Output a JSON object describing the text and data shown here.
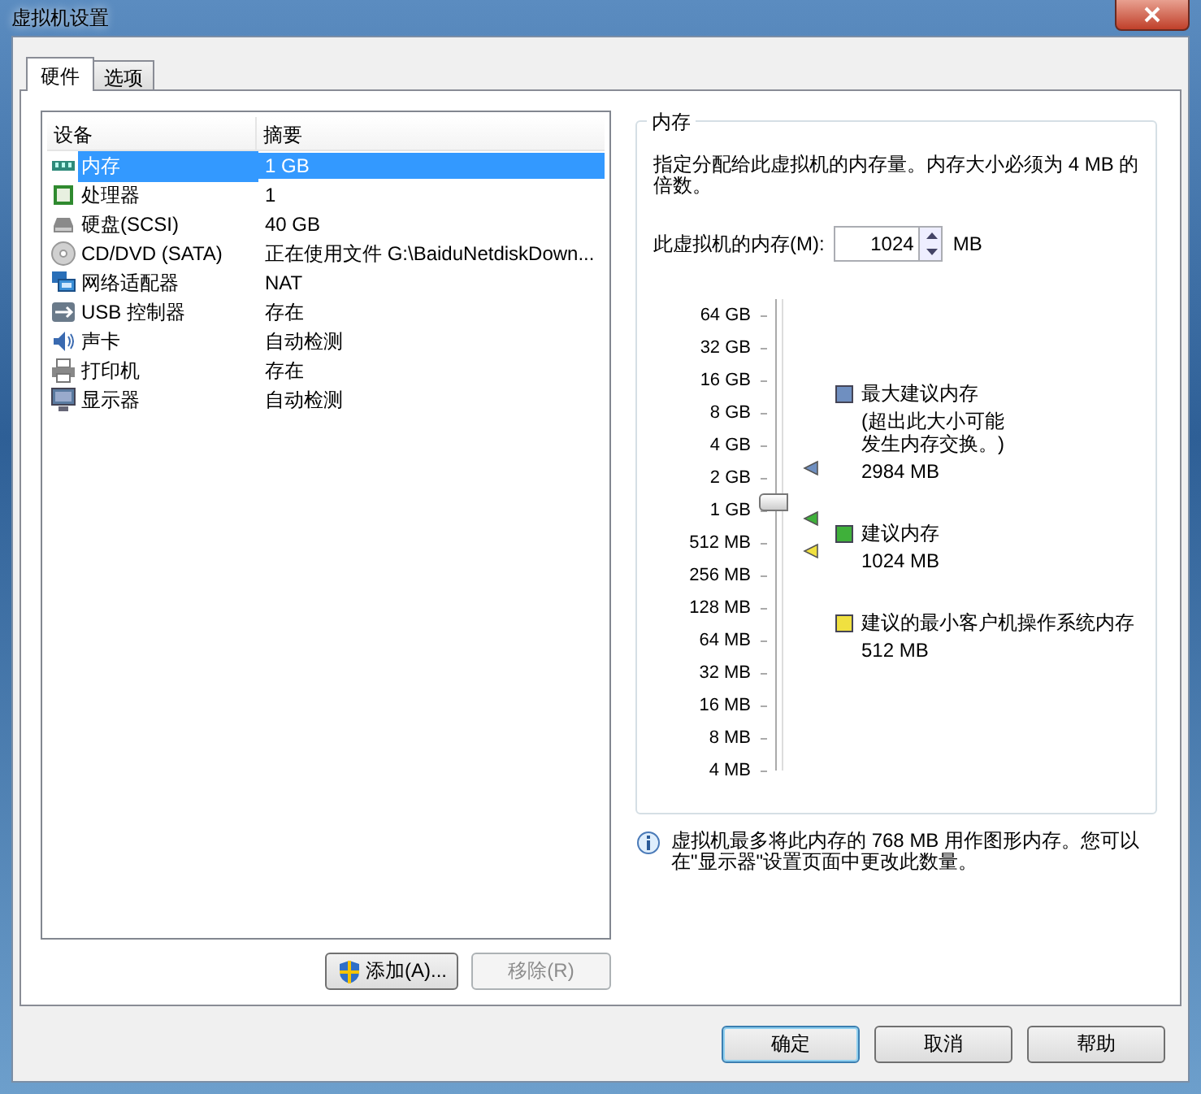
{
  "window": {
    "title": "虚拟机设置"
  },
  "tabs": [
    {
      "label": "硬件",
      "selected": true
    },
    {
      "label": "选项",
      "selected": false
    }
  ],
  "device_list": {
    "columns": [
      "设备",
      "摘要"
    ],
    "rows": [
      {
        "device": "内存",
        "summary": "1 GB",
        "selected": true
      },
      {
        "device": "处理器",
        "summary": "1",
        "selected": false
      },
      {
        "device": "硬盘(SCSI)",
        "summary": "40 GB",
        "selected": false
      },
      {
        "device": "CD/DVD (SATA)",
        "summary": "正在使用文件 G:\\BaiduNetdiskDown...",
        "selected": false
      },
      {
        "device": "网络适配器",
        "summary": "NAT",
        "selected": false
      },
      {
        "device": "USB 控制器",
        "summary": "存在",
        "selected": false
      },
      {
        "device": "声卡",
        "summary": "自动检测",
        "selected": false
      },
      {
        "device": "打印机",
        "summary": "存在",
        "selected": false
      },
      {
        "device": "显示器",
        "summary": "自动检测",
        "selected": false
      }
    ]
  },
  "list_buttons": [
    {
      "label": "添加(A)...",
      "disabled": false
    },
    {
      "label": "移除(R)",
      "disabled": true
    }
  ],
  "memory": {
    "title": "内存",
    "description": "指定分配给此虚拟机的内存量。内存大小必须为 4 MB 的倍数。",
    "field_label": "此虚拟机的内存(M):",
    "value": "1024",
    "unit": "MB",
    "slider": {
      "level": 0.571,
      "ticks": [
        "64 GB",
        "32 GB",
        "16 GB",
        "8 GB",
        "4 GB",
        "2 GB",
        "1 GB",
        "512 MB",
        "256 MB",
        "128 MB",
        "64 MB",
        "32 MB",
        "16 MB",
        "8 MB",
        "4 MB"
      ]
    },
    "legend": [
      {
        "label": "最大建议内存",
        "note": [
          "(超出此大小可能",
          "发生内存交换。)"
        ],
        "value": "2984 MB",
        "color": "#6f8fc0"
      },
      {
        "label": "建议内存",
        "value": "1024 MB",
        "color": "#3fb03a"
      },
      {
        "label": "建议的最小客户机操作系统内存",
        "value": "512 MB",
        "color": "#f0e040"
      }
    ]
  },
  "info": "虚拟机最多将此内存的 768 MB 用作图形内存。您可以在\"显示器\"设置页面中更改此数量。",
  "buttons": [
    {
      "label": "确定",
      "default": true
    },
    {
      "label": "取消",
      "default": false
    },
    {
      "label": "帮助",
      "default": false
    }
  ]
}
